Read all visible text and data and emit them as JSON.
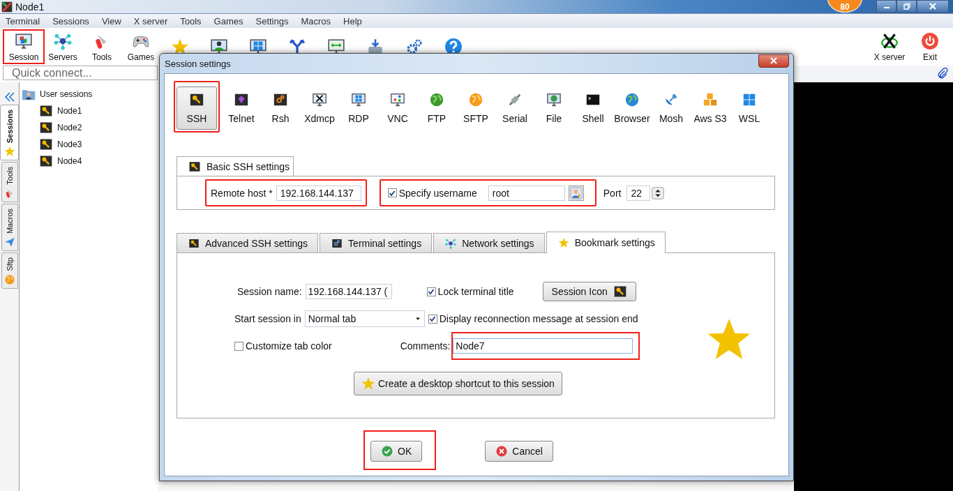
{
  "window": {
    "title": "Node1",
    "badge": "80"
  },
  "menu": [
    "Terminal",
    "Sessions",
    "View",
    "X server",
    "Tools",
    "Games",
    "Settings",
    "Macros",
    "Help"
  ],
  "toolbar": [
    {
      "kind": "session",
      "label": "Session",
      "highlighted": true
    },
    {
      "kind": "servers",
      "label": "Servers",
      "highlighted": false
    },
    {
      "kind": "tools",
      "label": "Tools",
      "highlighted": false
    },
    {
      "kind": "games",
      "label": "Games",
      "highlighted": false
    },
    {
      "kind": "star",
      "highlighted": false
    },
    {
      "kind": "user-monitor",
      "highlighted": false
    },
    {
      "kind": "windows-monitor",
      "highlighted": false
    },
    {
      "kind": "fork",
      "highlighted": false
    },
    {
      "kind": "network-monitor",
      "highlighted": false
    },
    {
      "kind": "drive",
      "highlighted": false
    },
    {
      "kind": "gears",
      "highlighted": false
    },
    {
      "kind": "help",
      "highlighted": false
    }
  ],
  "toolbar_right": [
    {
      "kind": "xserver",
      "label": "X server"
    },
    {
      "kind": "exit",
      "label": "Exit"
    }
  ],
  "quick_connect": {
    "placeholder": "Quick connect..."
  },
  "side_tabs": [
    {
      "kind": "star",
      "label": "Sessions",
      "selected": true
    },
    {
      "kind": "tools",
      "label": "Tools",
      "selected": false
    },
    {
      "kind": "plane",
      "label": "Macros",
      "selected": false
    },
    {
      "kind": "sftp",
      "label": "Sftp",
      "selected": false
    }
  ],
  "tree": {
    "label": "User sessions",
    "children": [
      {
        "label": "Node1"
      },
      {
        "label": "Node2"
      },
      {
        "label": "Node3"
      },
      {
        "label": "Node4"
      }
    ]
  },
  "dialog": {
    "title": "Session settings",
    "session_types": [
      {
        "kind": "ssh",
        "label": "SSH",
        "selected": true,
        "highlighted": true
      },
      {
        "kind": "telnet",
        "label": "Telnet",
        "selected": false,
        "highlighted": false
      },
      {
        "kind": "rsh",
        "label": "Rsh",
        "selected": false,
        "highlighted": false
      },
      {
        "kind": "xdmcp",
        "label": "Xdmcp",
        "selected": false,
        "highlighted": false
      },
      {
        "kind": "rdp",
        "label": "RDP",
        "selected": false,
        "highlighted": false
      },
      {
        "kind": "vnc",
        "label": "VNC",
        "selected": false,
        "highlighted": false
      },
      {
        "kind": "ftp",
        "label": "FTP",
        "selected": false,
        "highlighted": false
      },
      {
        "kind": "sftp",
        "label": "SFTP",
        "selected": false,
        "highlighted": false
      },
      {
        "kind": "serial",
        "label": "Serial",
        "selected": false,
        "highlighted": false
      },
      {
        "kind": "file",
        "label": "File",
        "selected": false,
        "highlighted": false
      },
      {
        "kind": "shell",
        "label": "Shell",
        "selected": false,
        "highlighted": false
      },
      {
        "kind": "browser",
        "label": "Browser",
        "selected": false,
        "highlighted": false
      },
      {
        "kind": "mosh",
        "label": "Mosh",
        "selected": false,
        "highlighted": false
      },
      {
        "kind": "s3",
        "label": "Aws S3",
        "selected": false,
        "highlighted": false
      },
      {
        "kind": "wsl",
        "label": "WSL",
        "selected": false,
        "highlighted": false
      }
    ],
    "basic": {
      "tab": "Basic SSH settings",
      "remote_host": {
        "label": "Remote host *",
        "value": "192.168.144.137",
        "highlighted": true
      },
      "username": {
        "label": "Specify username",
        "checked": true,
        "value": "root",
        "highlighted": true
      },
      "port": {
        "label": "Port",
        "value": "22"
      }
    },
    "tabs": [
      {
        "kind": "ssh",
        "label": "Advanced SSH settings",
        "selected": false
      },
      {
        "kind": "terminal",
        "label": "Terminal settings",
        "selected": false
      },
      {
        "kind": "servers",
        "label": "Network settings",
        "selected": false
      },
      {
        "kind": "star",
        "label": "Bookmark settings",
        "selected": true
      }
    ],
    "bookmark": {
      "session_name": {
        "label": "Session name:",
        "value": "192.168.144.137 ("
      },
      "lock_title": {
        "label": "Lock terminal title",
        "checked": true
      },
      "session_icon": "Session Icon",
      "start_session": {
        "label": "Start session in",
        "value": "Normal tab"
      },
      "reconnect_message": {
        "label": "Display reconnection message at session end",
        "checked": true
      },
      "tab_color": {
        "label": "Customize tab color",
        "checked": false
      },
      "comments": {
        "label": "Comments:",
        "value": "Node7",
        "highlighted": true
      },
      "shortcut": "Create a desktop shortcut to this session"
    },
    "buttons": [
      {
        "kind": "ok",
        "label": "OK",
        "highlighted": true
      },
      {
        "kind": "cancel",
        "label": "Cancel",
        "highlighted": false
      }
    ]
  }
}
